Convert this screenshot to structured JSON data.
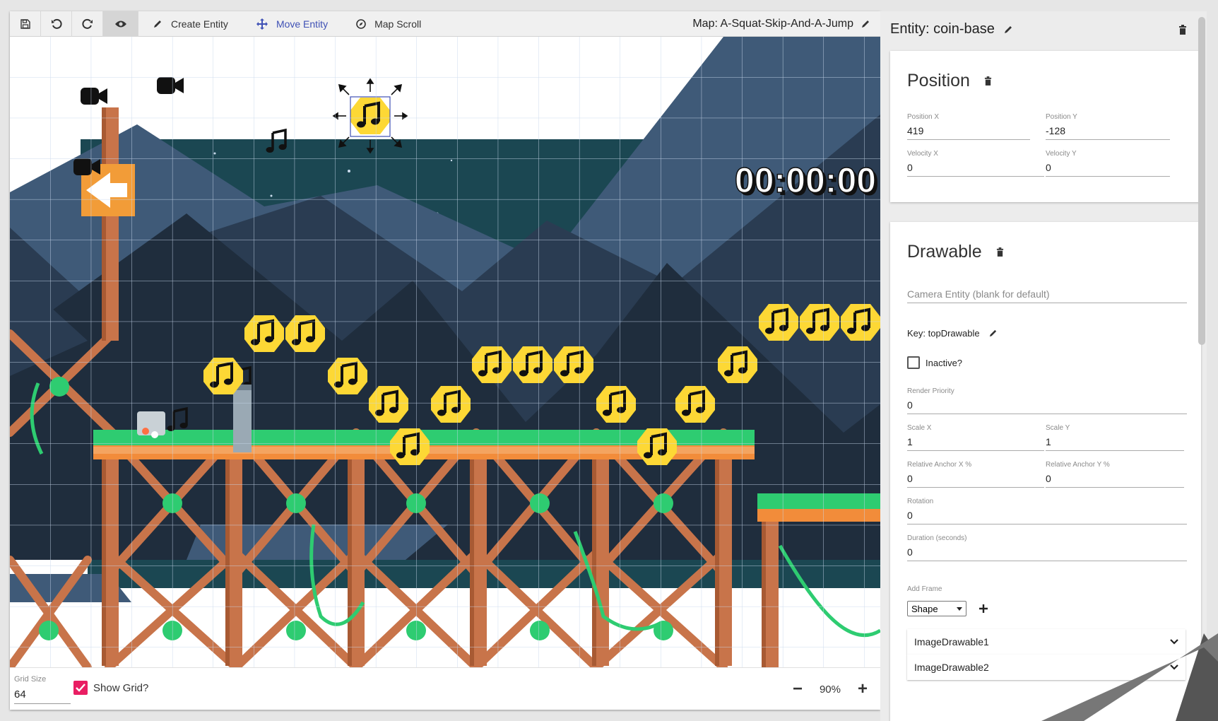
{
  "toolbar": {
    "save_icon": "save-icon",
    "undo_icon": "undo-icon",
    "redo_icon": "redo-icon",
    "preview_icon": "eye-icon",
    "tools": [
      {
        "label": "Create Entity",
        "icon": "pencil-icon"
      },
      {
        "label": "Move Entity",
        "icon": "move-arrows-icon"
      },
      {
        "label": "Map Scroll",
        "icon": "compass-icon"
      }
    ],
    "map_title": "Map: A-Squat-Skip-And-A-Jump"
  },
  "canvas": {
    "timer_text": "00:00:00",
    "entity_icons": [
      "camera-icon",
      "music-note-icon",
      "arrow-left-sign"
    ]
  },
  "bottombar": {
    "grid_size_label": "Grid Size",
    "grid_size_value": "64",
    "show_grid_label": "Show Grid?",
    "show_grid_checked": true,
    "zoom_value": "90%"
  },
  "entity": {
    "title": "Entity: coin-base",
    "position": {
      "title": "Position",
      "position_x_label": "Position X",
      "position_x": "419",
      "position_y_label": "Position Y",
      "position_y": "-128",
      "velocity_x_label": "Velocity X",
      "velocity_x": "0",
      "velocity_y_label": "Velocity Y",
      "velocity_y": "0"
    },
    "drawable": {
      "title": "Drawable",
      "camera_placeholder": "Camera Entity (blank for default)",
      "key_label": "Key: topDrawable",
      "inactive_label": "Inactive?",
      "render_priority_label": "Render Priority",
      "render_priority": "0",
      "scale_x_label": "Scale X",
      "scale_x": "1",
      "scale_y_label": "Scale Y",
      "scale_y": "1",
      "anchor_x_label": "Relative Anchor X %",
      "anchor_x": "0",
      "anchor_y_label": "Relative Anchor Y %",
      "anchor_y": "0",
      "rotation_label": "Rotation",
      "rotation": "0",
      "duration_label": "Duration (seconds)",
      "duration": "0",
      "add_frame_label": "Add Frame",
      "frame_type": "Shape",
      "frames": [
        "ImageDrawable1",
        "ImageDrawable2"
      ]
    }
  },
  "colors": {
    "accent": "#3f51b5",
    "checkbox": "#e91e63",
    "coin": "#fdd835",
    "scaffold": "#c8744a",
    "grass": "#2ecc71",
    "sky_dark": "#1b4752",
    "mountain": "#3f5a78"
  }
}
